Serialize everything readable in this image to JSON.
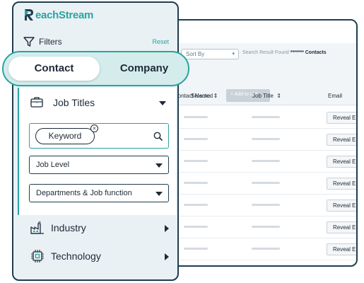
{
  "brand": {
    "logo_text": "eachStream",
    "logo_initial": "R",
    "accent": "#2aa3a0",
    "dark": "#1f3d4f"
  },
  "filters": {
    "title": "Filters",
    "reset": "Reset",
    "icon": "funnel-icon"
  },
  "toggle": {
    "options": [
      "Contact",
      "Company"
    ],
    "selected": "Contact"
  },
  "job_titles": {
    "title": "Job Titles",
    "keyword_chip": "Keyword",
    "dropdowns": [
      "Job Level",
      "Departments & Job function"
    ]
  },
  "sections": [
    {
      "label": "Industry",
      "icon": "factory-icon"
    },
    {
      "label": "Technology",
      "icon": "chip-icon"
    }
  ],
  "results": {
    "sort_by": "Sort By",
    "found_prefix": "Search Result Found",
    "found_count": "*******",
    "found_suffix": "Contacts",
    "selected": "Selected",
    "add_to_list": "+ Add to List",
    "columns": [
      "Contact Name",
      "Job Title",
      "Email"
    ],
    "reveal_label": "Reveal Email"
  }
}
